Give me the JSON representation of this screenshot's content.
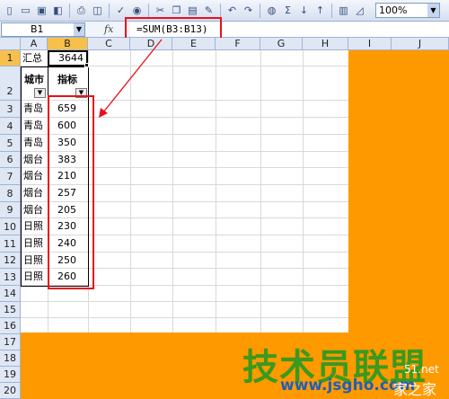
{
  "toolbar": {
    "zoom": "100%"
  },
  "formula_bar": {
    "name_box": "B1",
    "fx": "fx",
    "formula": "=SUM(B3:B13)"
  },
  "columns": [
    "A",
    "B",
    "C",
    "D",
    "E",
    "F",
    "G",
    "H",
    "I",
    "J"
  ],
  "rows": [
    "1",
    "2",
    "3",
    "4",
    "5",
    "6",
    "7",
    "8",
    "9",
    "10",
    "11",
    "12",
    "13",
    "14",
    "15",
    "16",
    "17",
    "18",
    "19",
    "20"
  ],
  "cells": {
    "a1": "汇总",
    "b1": "3644",
    "a2": "城市",
    "b2": "指标",
    "data": [
      {
        "city": "青岛",
        "value": "659"
      },
      {
        "city": "青岛",
        "value": "600"
      },
      {
        "city": "青岛",
        "value": "350"
      },
      {
        "city": "烟台",
        "value": "383"
      },
      {
        "city": "烟台",
        "value": "210"
      },
      {
        "city": "烟台",
        "value": "257"
      },
      {
        "city": "烟台",
        "value": "205"
      },
      {
        "city": "日照",
        "value": "230"
      },
      {
        "city": "日照",
        "value": "240"
      },
      {
        "city": "日照",
        "value": "250"
      },
      {
        "city": "日照",
        "value": "260"
      }
    ]
  },
  "watermark": {
    "brand": "技术员联盟",
    "url": "www.jsgho.com",
    "side_top": "51.net",
    "side_bottom": "家之家"
  },
  "colors": {
    "highlight": "#e8101a",
    "background": "#ff9900",
    "selected_header": "#f7c04a"
  }
}
